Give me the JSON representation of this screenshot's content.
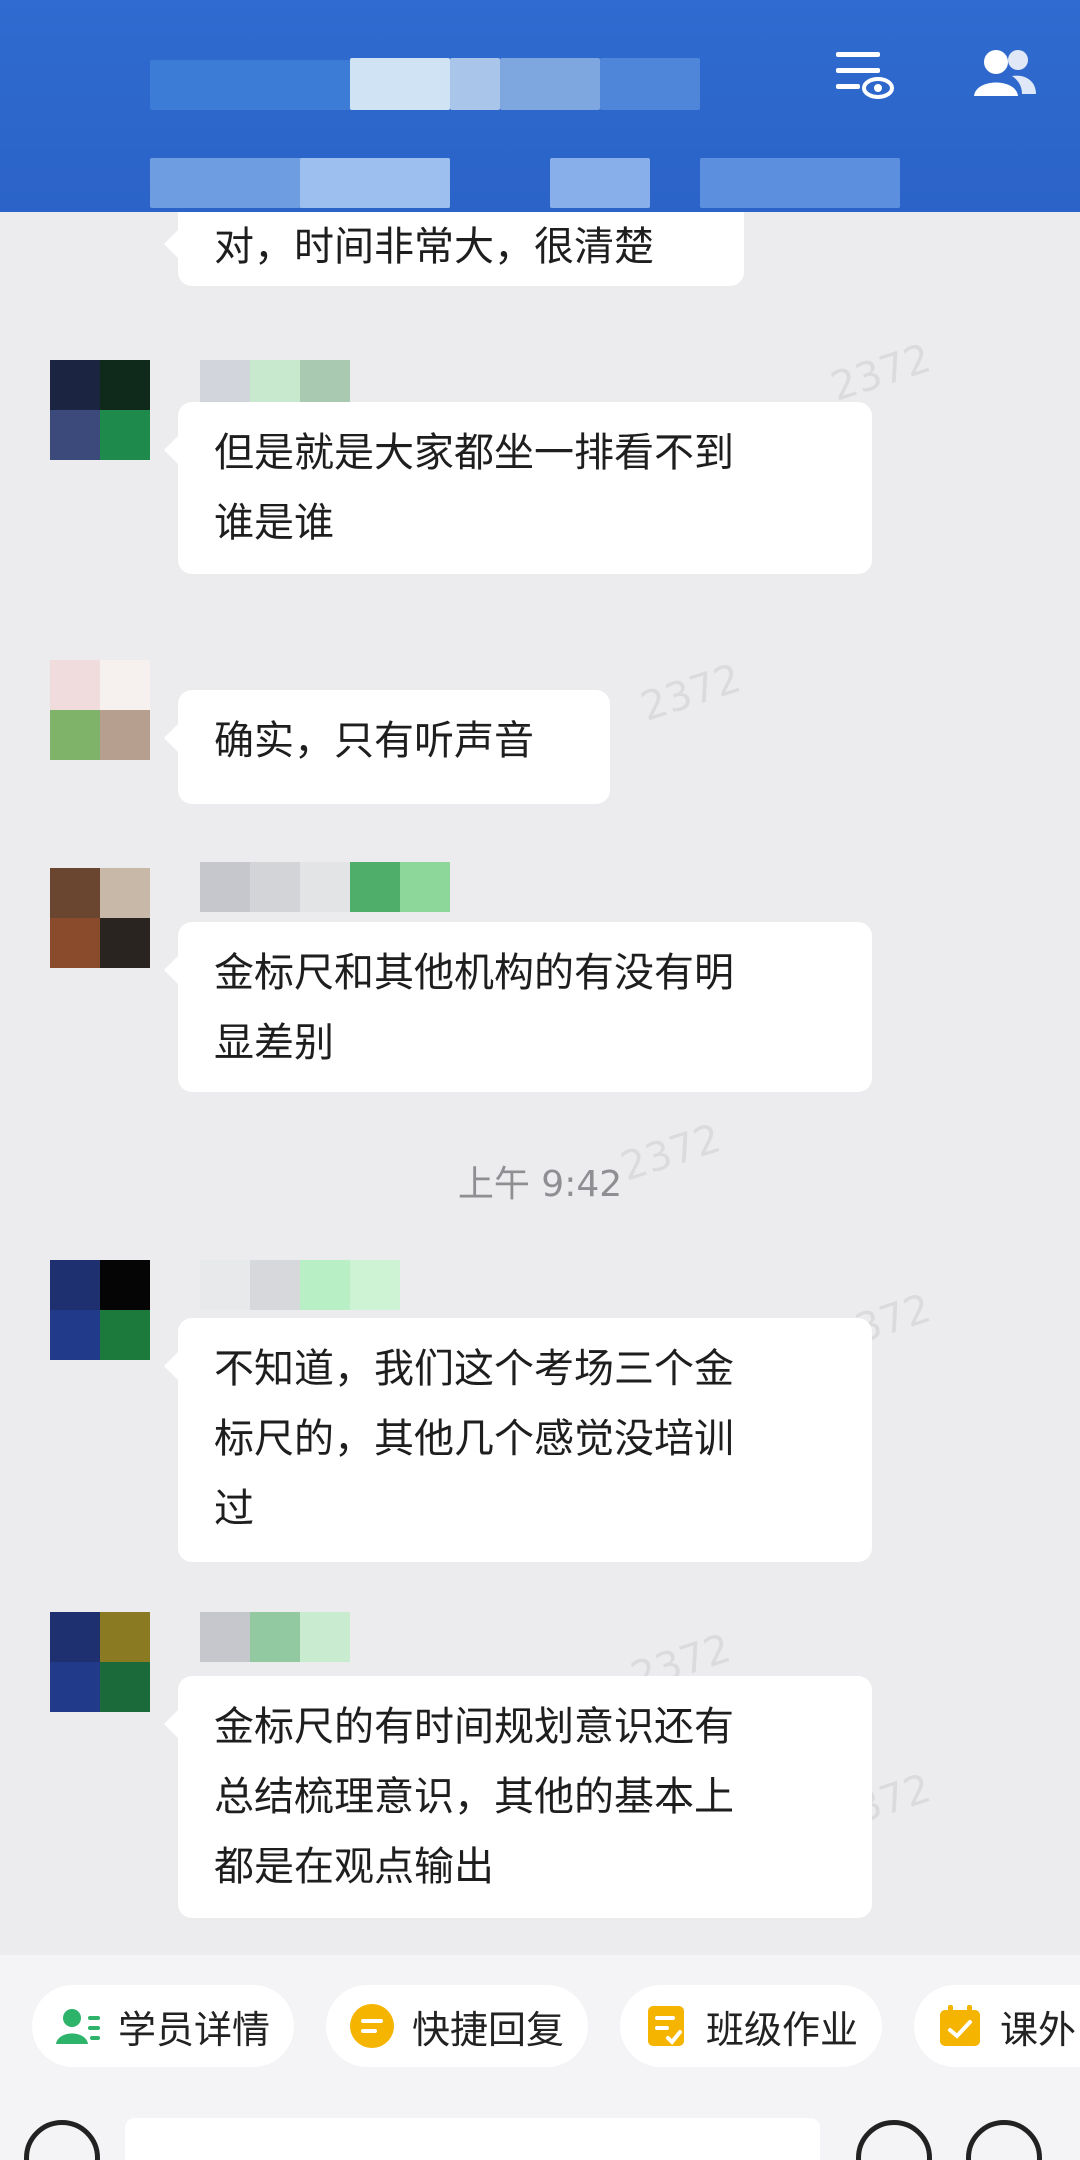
{
  "header": {
    "menu_icon": "list-settings-icon",
    "members_icon": "group-members-icon"
  },
  "messages": [
    {
      "text": "对，时间非常大，很清楚"
    },
    {
      "text": "但是就是大家都坐一排看不到\n谁是谁"
    },
    {
      "text": "确实，只有听声音"
    },
    {
      "text": "金标尺和其他机构的有没有明\n显差别"
    },
    {
      "text": "不知道，我们这个考场三个金\n标尺的，其他几个感觉没培训\n过"
    },
    {
      "text": "金标尺的有时间规划意识还有\n总结梳理意识，其他的基本上\n都是在观点输出"
    }
  ],
  "timestamp": "上午 9:42",
  "watermark": "2372",
  "quick_actions": [
    {
      "label": "学员详情",
      "icon": "student-details-icon",
      "color": "#2db36a"
    },
    {
      "label": "快捷回复",
      "icon": "quick-reply-icon",
      "color": "#f5b400"
    },
    {
      "label": "班级作业",
      "icon": "class-homework-icon",
      "color": "#f5b400"
    },
    {
      "label": "课外",
      "icon": "extracurricular-icon",
      "color": "#f5b400"
    }
  ],
  "input_bar": {
    "voice_icon": "voice-icon",
    "emoji_icon": "emoji-icon",
    "add_icon": "add-icon"
  }
}
